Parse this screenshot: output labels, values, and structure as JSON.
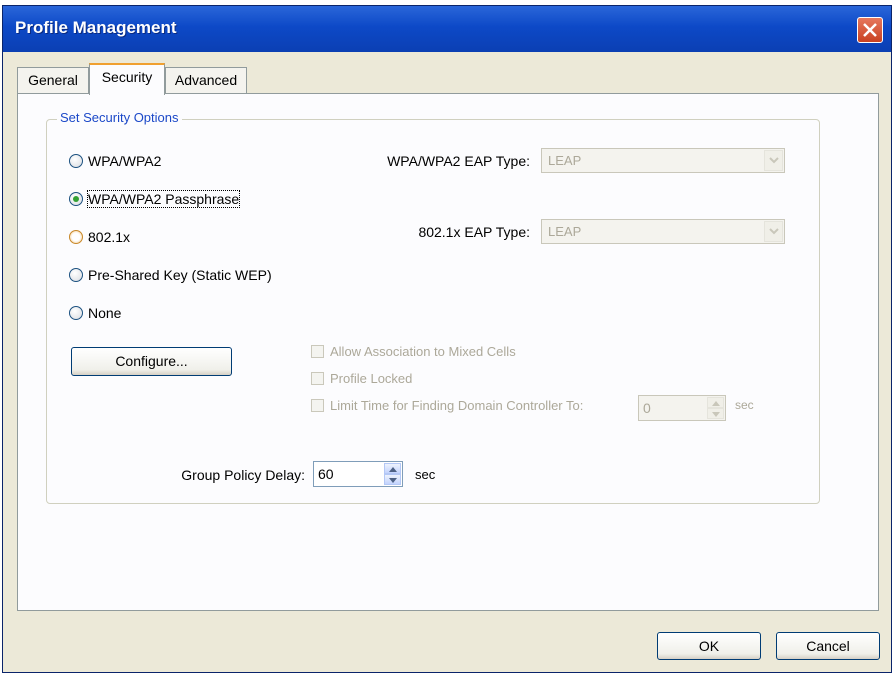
{
  "window": {
    "title": "Profile Management"
  },
  "tabs": [
    {
      "label": "General"
    },
    {
      "label": "Security"
    },
    {
      "label": "Advanced"
    }
  ],
  "security": {
    "group_label": "Set Security Options",
    "options": [
      {
        "label": "WPA/WPA2",
        "checked": false
      },
      {
        "label": "WPA/WPA2 Passphrase",
        "checked": true
      },
      {
        "label": "802.1x",
        "checked": false
      },
      {
        "label": "Pre-Shared Key (Static WEP)",
        "checked": false
      },
      {
        "label": "None",
        "checked": false
      }
    ],
    "wpa_eap_type_label": "WPA/WPA2 EAP Type:",
    "wpa_eap_type_value": "LEAP",
    "dot1x_eap_type_label": "802.1x EAP Type:",
    "dot1x_eap_type_value": "LEAP",
    "configure_label": "Configure...",
    "checkboxes": [
      {
        "label": "Allow Association to Mixed Cells",
        "checked": false
      },
      {
        "label": "Profile Locked",
        "checked": false
      },
      {
        "label": "Limit Time for Finding Domain Controller To:",
        "checked": false
      }
    ],
    "limit_time_value": "0",
    "limit_time_unit": "sec",
    "group_policy_label": "Group Policy Delay:",
    "group_policy_value": "60",
    "group_policy_unit": "sec"
  },
  "footer": {
    "ok_label": "OK",
    "cancel_label": "Cancel"
  },
  "colors": {
    "titlebar": "#0d49c7",
    "dialog_bg": "#ece9d8",
    "group_label": "#1b48c8",
    "active_tab_accent": "#f0a030"
  }
}
